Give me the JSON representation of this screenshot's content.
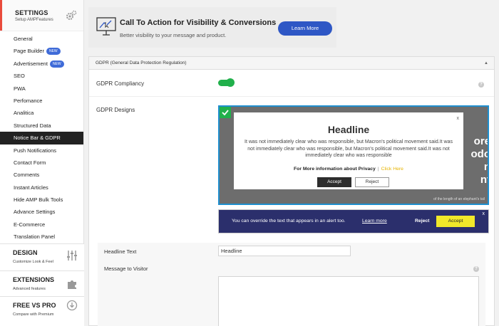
{
  "sidebar": {
    "settings": {
      "title": "SETTINGS",
      "subtitle": "Setup AMPFeatures",
      "icon": "gears-icon"
    },
    "items": [
      {
        "label": "General"
      },
      {
        "label": "Page Builder",
        "badge": "NEW"
      },
      {
        "label": "Advertisement",
        "badge": "NEW"
      },
      {
        "label": "SEO"
      },
      {
        "label": "PWA"
      },
      {
        "label": "Perfomance"
      },
      {
        "label": "Analitica"
      },
      {
        "label": "Structured Data"
      },
      {
        "label": "Notice Bar & GDPR",
        "active": true
      },
      {
        "label": "Push Notifications"
      },
      {
        "label": "Contact Form"
      },
      {
        "label": "Comments"
      },
      {
        "label": "Instant Articles"
      },
      {
        "label": "Hide AMP Bulk Tools"
      },
      {
        "label": "Advance Settings"
      },
      {
        "label": "E-Commerce"
      },
      {
        "label": "Translation Panel"
      }
    ],
    "design": {
      "title": "DESIGN",
      "subtitle": "Customize Look & Feel",
      "icon": "sliders-icon"
    },
    "extensions": {
      "title": "EXTENSIONS",
      "subtitle": "Advanced features",
      "icon": "puzzle-icon"
    },
    "free_vs_pro": {
      "title": "FREE VS PRO",
      "subtitle": "Compare with Premium",
      "icon": "download-circle-icon"
    }
  },
  "cta": {
    "title": "Call To Action for Visibility & Conversions",
    "subtitle": "Better visibility to your message and product.",
    "button": "Learn More"
  },
  "panel": {
    "header": "GDPR (General Data Protection Regulation)",
    "compliancy_label": "GDPR Compliancy",
    "compliancy_on": true,
    "designs_label": "GDPR Designs",
    "design1": {
      "headline": "Headline",
      "message": "It was not immediately clear who was responsible, but Macron's political movement said.It was not immediately clear who was responsible, but Macron's political movement said.It was not immediately clear who was responsible",
      "more_info": "For More information about Privacy",
      "separator": "|",
      "link": "Click Here",
      "accept": "Accept",
      "reject": "Reject",
      "close": "x",
      "bg_fragments": [
        "ore",
        "odo",
        "n",
        "nt"
      ],
      "bg_caption": "of the length of an elephant's tail"
    },
    "design2": {
      "message": "You can override the text that appears in an alert too.",
      "learn_more": "Learn more",
      "reject": "Reject",
      "accept": "Accept",
      "close": "x"
    },
    "headline_text_label": "Headline Text",
    "headline_text_value": "Headline",
    "message_label": "Message to Visitor",
    "message_value": ""
  },
  "colors": {
    "accent_red": "#e94b3c",
    "toggle_green": "#21b04b",
    "cta_blue": "#2e57c5",
    "bar_navy": "#2b2f6c",
    "accept_yellow": "#f1e82a"
  }
}
